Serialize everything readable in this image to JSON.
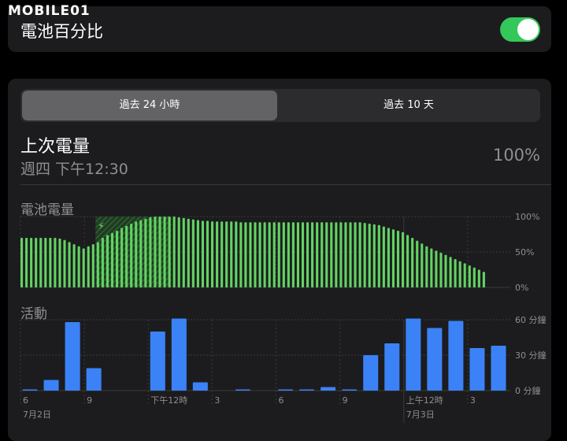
{
  "watermark": "MOBILE01",
  "battery_percentage": {
    "label": "電池百分比",
    "enabled": true
  },
  "segmented": {
    "options": [
      "過去 24 小時",
      "過去 10 天"
    ],
    "selected": 0
  },
  "last_charge": {
    "title": "上次電量",
    "time": "週四 下午12:30",
    "percent": "100%"
  },
  "battery_level": {
    "title": "電池電量",
    "charging_icon": "bolt-icon",
    "y_labels": [
      "100%",
      "50%",
      "0%"
    ]
  },
  "activity": {
    "title": "活動",
    "y_labels": [
      "60 分鐘",
      "30 分鐘",
      "0 分鐘"
    ]
  },
  "x_labels": [
    "6",
    "9",
    "下午12時",
    "3",
    "6",
    "9",
    "上午12時",
    "3"
  ],
  "date_labels": [
    "7月2日",
    "7月3日"
  ],
  "colors": {
    "battery": "#63d363",
    "activity": "#3b82f6",
    "toggle": "#34c759"
  },
  "chart_data": [
    {
      "type": "bar",
      "title": "電池電量",
      "ylim": [
        0,
        100
      ],
      "y_unit": "%",
      "charging_range_bars": [
        16,
        31
      ],
      "values": [
        70,
        70,
        70,
        70,
        70,
        70,
        70,
        70,
        69,
        67,
        64,
        61,
        58,
        55,
        58,
        61,
        64,
        70,
        74,
        77,
        80,
        84,
        87,
        90,
        93,
        95,
        97,
        99,
        100,
        100,
        100,
        100,
        100,
        99,
        98,
        97,
        96,
        95,
        94,
        94,
        93,
        93,
        93,
        93,
        93,
        93,
        92,
        92,
        92,
        92,
        92,
        92,
        92,
        92,
        92,
        92,
        92,
        92,
        92,
        92,
        92,
        92,
        92,
        92,
        92,
        92,
        92,
        92,
        92,
        92,
        92,
        92,
        91,
        90,
        89,
        88,
        86,
        84,
        82,
        80,
        78,
        74,
        70,
        66,
        62,
        58,
        55,
        52,
        49,
        46,
        43,
        40,
        37,
        34,
        31,
        28,
        25,
        22
      ]
    },
    {
      "type": "bar",
      "title": "活動",
      "ylim": [
        0,
        60
      ],
      "y_unit": "分鐘",
      "hours": [
        "6",
        "7",
        "8",
        "9",
        "10",
        "11",
        "12",
        "13",
        "14",
        "15",
        "16",
        "17",
        "18",
        "19",
        "20",
        "21",
        "22",
        "23",
        "0",
        "1",
        "2",
        "3",
        "4"
      ],
      "values": [
        1,
        9,
        58,
        19,
        0,
        0,
        50,
        61,
        7,
        0,
        1,
        0,
        1,
        1,
        3,
        1,
        30,
        40,
        61,
        53,
        59,
        36,
        38
      ]
    }
  ]
}
